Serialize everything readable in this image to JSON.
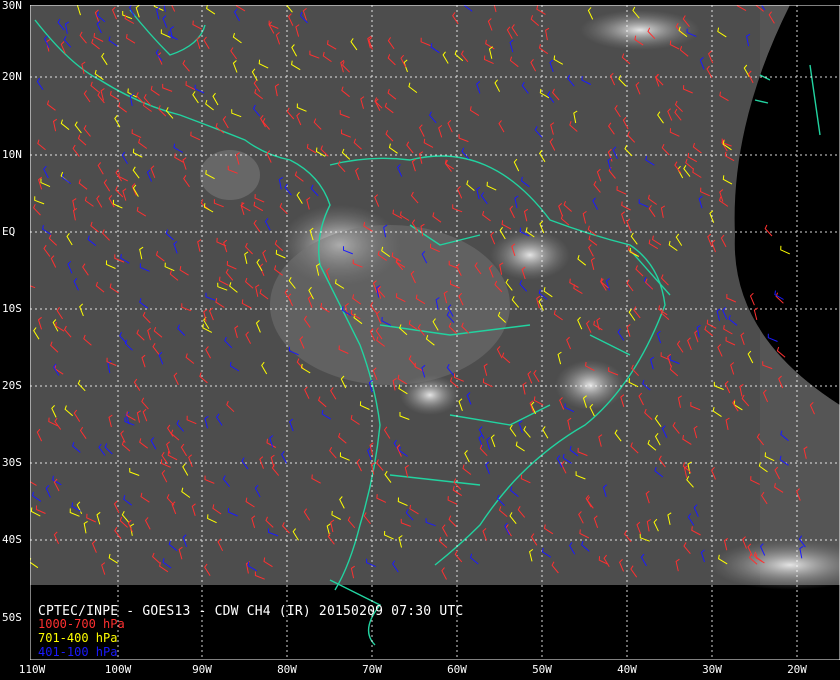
{
  "caption": "CPTEC/INPE - GOES13 - CDW CH4 (IR) 20150209 07:30 UTC",
  "legend": [
    {
      "label": "1000-700 hPa",
      "color": "#ff3030"
    },
    {
      "label": "701-400 hPa",
      "color": "#ffff00"
    },
    {
      "label": "401-100 hPa",
      "color": "#1a1aff"
    }
  ],
  "lat_labels": [
    "30N",
    "20N",
    "10N",
    "EQ",
    "10S",
    "20S",
    "30S",
    "40S",
    "50S"
  ],
  "lon_labels": [
    "110W",
    "100W",
    "90W",
    "80W",
    "70W",
    "60W",
    "50W",
    "40W",
    "30W",
    "20W"
  ],
  "colors": {
    "coastline": "#22d3a0",
    "grid": "#ffffff",
    "background": "#000000"
  }
}
